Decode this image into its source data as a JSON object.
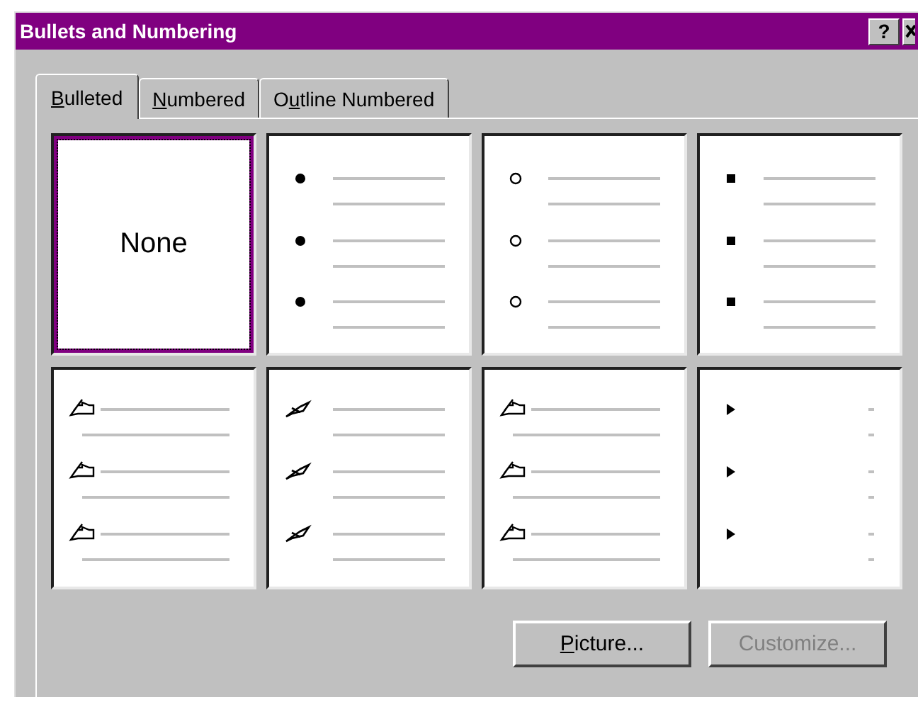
{
  "window": {
    "title": "Bullets and Numbering",
    "help": "?"
  },
  "tabs": [
    {
      "label": "Bulleted",
      "selected": true
    },
    {
      "label": "Numbered",
      "selected": false
    },
    {
      "label": "Outline Numbered",
      "selected": false
    }
  ],
  "styles": [
    {
      "kind": "none",
      "label": "None",
      "selected": true
    },
    {
      "kind": "disc",
      "selected": false
    },
    {
      "kind": "circle",
      "selected": false
    },
    {
      "kind": "square",
      "selected": false
    },
    {
      "kind": "hand",
      "selected": false
    },
    {
      "kind": "pen",
      "selected": false
    },
    {
      "kind": "hand",
      "selected": false
    },
    {
      "kind": "arrow",
      "selected": false
    }
  ],
  "buttons": [
    {
      "label": "Picture...",
      "disabled": false
    },
    {
      "label": "Customize...",
      "disabled": true
    }
  ]
}
